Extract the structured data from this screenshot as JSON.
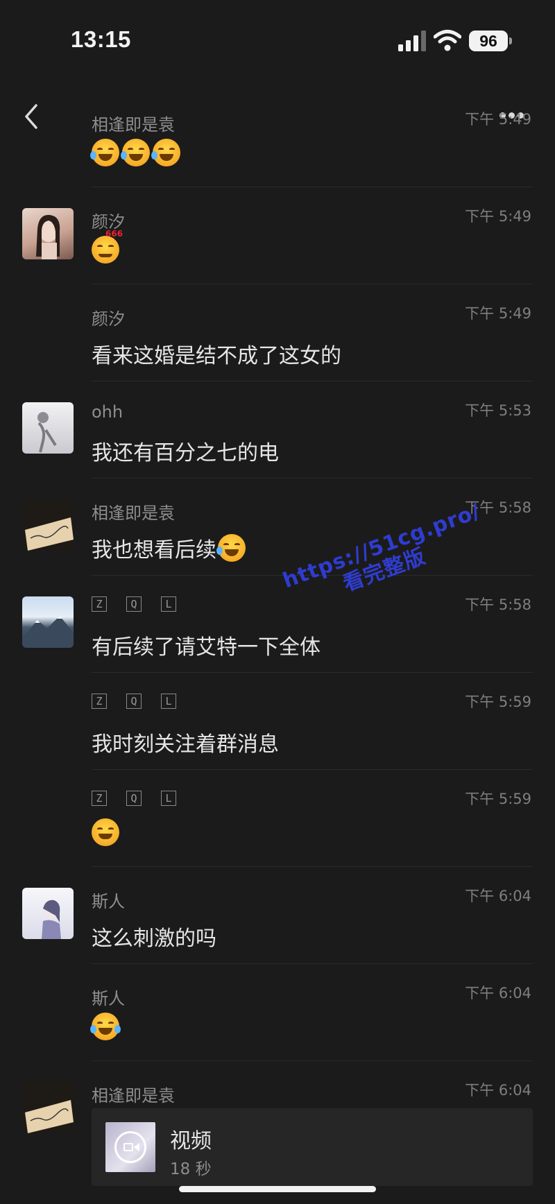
{
  "status_bar": {
    "time": "13:15",
    "battery": "96"
  },
  "nav": {
    "back_icon": "chevron-left-icon",
    "more_icon": "ellipsis-icon"
  },
  "messages": [
    {
      "sender": "相逢即是袁",
      "time": "下午 5:49",
      "emojis": [
        "laugh-cry",
        "laugh-cry",
        "laugh-cry"
      ],
      "avatar": "none"
    },
    {
      "sender": "颜汐",
      "time": "下午 5:49",
      "emojis": [
        "666-smirk"
      ],
      "avatar": "girl-portrait"
    },
    {
      "sender": "颜汐",
      "time": "下午 5:49",
      "text": "看来这婚是结不成了这女的",
      "avatar": "none"
    },
    {
      "sender": "ohh",
      "time": "下午 5:53",
      "text": "我还有百分之七的电",
      "avatar": "sketch-figure"
    },
    {
      "sender": "相逢即是袁",
      "time": "下午 5:58",
      "text": "我也想看后续",
      "emojis": [
        "laugh-cry"
      ],
      "avatar": "handwriting-card"
    },
    {
      "sender_letters": [
        "Z",
        "Q",
        "L"
      ],
      "time": "下午 5:58",
      "text": "有后续了请艾特一下全体",
      "avatar": "mountain"
    },
    {
      "sender_letters": [
        "Z",
        "Q",
        "L"
      ],
      "time": "下午 5:59",
      "text": "我时刻关注着群消息",
      "avatar": "none"
    },
    {
      "sender_letters": [
        "Z",
        "Q",
        "L"
      ],
      "time": "下午 5:59",
      "emojis": [
        "smile"
      ],
      "avatar": "none"
    },
    {
      "sender": "斯人",
      "time": "下午 6:04",
      "text": "这么刺激的吗",
      "avatar": "anime-girl"
    },
    {
      "sender": "斯人",
      "time": "下午 6:04",
      "emojis": [
        "laugh-cry"
      ],
      "avatar": "none"
    },
    {
      "sender": "相逢即是袁",
      "time": "下午 6:04",
      "avatar": "handwriting-card"
    }
  ],
  "video": {
    "title": "视频",
    "duration": "18 秒"
  },
  "watermark": {
    "line1": "https://51cg.pro/",
    "line2": "看完整版"
  }
}
